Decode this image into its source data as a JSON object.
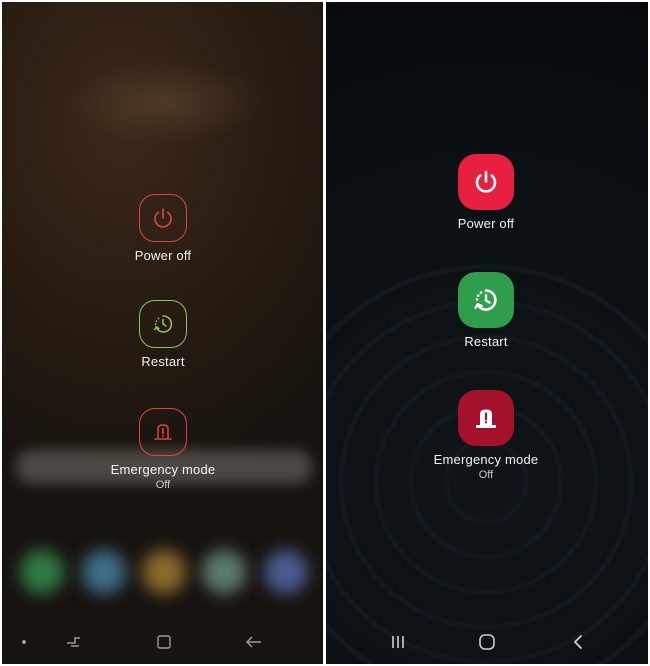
{
  "left": {
    "power_off_label": "Power off",
    "restart_label": "Restart",
    "emergency_label": "Emergency mode",
    "emergency_status": "Off",
    "colors": {
      "power": "#e0453c",
      "restart": "#8dc253",
      "emergency": "#e0453c"
    }
  },
  "right": {
    "power_off_label": "Power off",
    "restart_label": "Restart",
    "emergency_label": "Emergency mode",
    "emergency_status": "Off",
    "colors": {
      "power": "#e8203f",
      "restart": "#2e9e4c",
      "emergency": "#a3122a"
    }
  },
  "icons": {
    "power": "power-icon",
    "restart": "restart-icon",
    "emergency": "emergency-siren-icon",
    "nav_left_old": "recents-icon",
    "nav_home_old": "home-icon",
    "nav_back_old": "back-icon",
    "nav_recents": "recents-icon",
    "nav_home": "home-icon",
    "nav_back": "back-icon"
  }
}
